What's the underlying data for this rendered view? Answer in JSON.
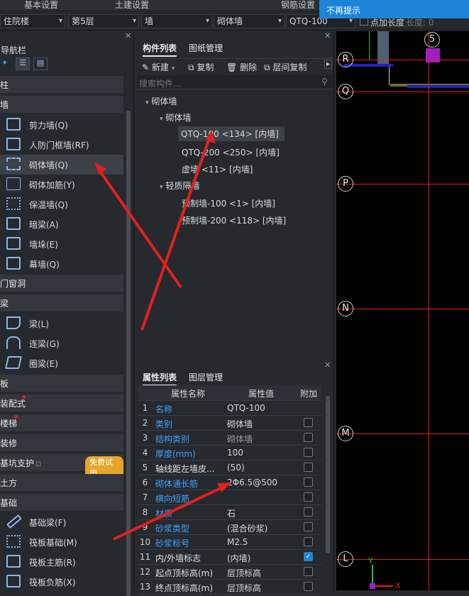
{
  "topbar": {
    "tab1": "基本设置",
    "tab2": "土建设置",
    "tab3": "钢筋设置",
    "notice": "不再提示"
  },
  "selectors": {
    "building": "住院楼",
    "floor": "第5层",
    "category": "墙",
    "subcategory": "砌体墙",
    "component": "QTQ-100",
    "add_length_label": "点加长度",
    "length_label": "长度: 0"
  },
  "nav": {
    "title": "导航栏",
    "categories": [
      "柱",
      "墙",
      "门窗洞",
      "梁",
      "板",
      "装配式",
      "楼梯",
      "装修",
      "基坑支护",
      "土方",
      "基础"
    ],
    "wall_items": [
      "剪力墙(Q)",
      "人防门框墙(RF)",
      "砌体墙(Q)",
      "砌体加筋(Y)",
      "保温墙(Q)",
      "暗梁(A)",
      "墙垛(E)",
      "幕墙(Q)"
    ],
    "beam_items": [
      "梁(L)",
      "连梁(G)",
      "圈梁(E)"
    ],
    "foundation_items": [
      "基础梁(F)",
      "筏板基础(M)",
      "筏板主筋(R)",
      "筏板负筋(X)"
    ],
    "trial_badge": "免费试用"
  },
  "components": {
    "tab_list": "构件列表",
    "tab_drawing": "图纸管理",
    "btn_new": "新建",
    "btn_copy": "复制",
    "btn_delete": "删除",
    "btn_floor_copy": "层间复制",
    "search_placeholder": "搜索构件...",
    "tree_root": "砌体墙",
    "group1": "砌体墙",
    "group1_items": [
      "QTQ-100 <134> [内墙]",
      "QTQ-200 <250> [内墙]",
      "虚墙 <11> [内墙]"
    ],
    "group2": "轻质隔墙",
    "group2_items": [
      "预制墙-100 <1> [内墙]",
      "预制墙-200 <118> [内墙]"
    ]
  },
  "properties": {
    "tab_props": "属性列表",
    "tab_layers": "图层管理",
    "col_name": "属性名称",
    "col_value": "属性值",
    "col_extra": "附加",
    "rows": [
      {
        "no": "1",
        "name": "名称",
        "value": "QTQ-100"
      },
      {
        "no": "2",
        "name": "类别",
        "value": "砌体墙"
      },
      {
        "no": "3",
        "name": "结构类别",
        "value": "砌体墙"
      },
      {
        "no": "4",
        "name": "厚度(mm)",
        "value": "100"
      },
      {
        "no": "5",
        "name": "轴线距左墙皮...",
        "value": "(50)"
      },
      {
        "no": "6",
        "name": "砌体通长筋",
        "value": "2Φ6.5@500"
      },
      {
        "no": "7",
        "name": "横向短筋",
        "value": ""
      },
      {
        "no": "8",
        "name": "材质",
        "value": "石"
      },
      {
        "no": "9",
        "name": "砂浆类型",
        "value": "(混合砂浆)"
      },
      {
        "no": "10",
        "name": "砂浆标号",
        "value": "M2.5"
      },
      {
        "no": "11",
        "name": "内/外墙标志",
        "value": "(内墙)"
      },
      {
        "no": "12",
        "name": "起点顶标高(m)",
        "value": "层顶标高"
      },
      {
        "no": "13",
        "name": "终点顶标高(m)",
        "value": "层顶标高"
      }
    ]
  },
  "canvas": {
    "axes": [
      "R",
      "Q",
      "P",
      "N",
      "M",
      "L"
    ],
    "top_axis": "5",
    "coord_x": "X",
    "coord_y": "Y",
    "accent_red": "#e02020",
    "accent_blue": "#3ea1ff"
  }
}
